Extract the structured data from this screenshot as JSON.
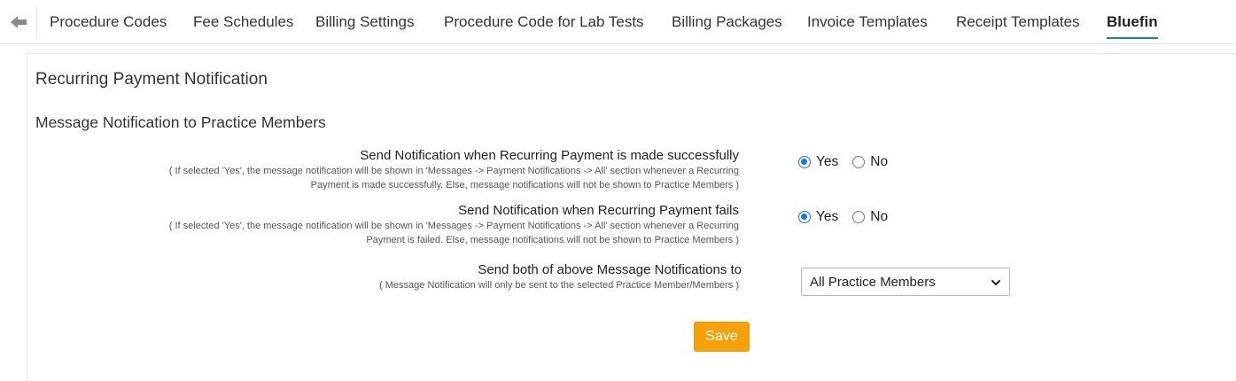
{
  "tabs": [
    {
      "label": "Procedure Codes"
    },
    {
      "label": "Fee Schedules"
    },
    {
      "label": "Billing Settings"
    },
    {
      "label": "Procedure Code for Lab Tests"
    },
    {
      "label": "Billing Packages"
    },
    {
      "label": "Invoice Templates"
    },
    {
      "label": "Receipt Templates"
    },
    {
      "label": "Bluefin"
    }
  ],
  "active_tab": "Bluefin",
  "page": {
    "title": "Recurring Payment Notification",
    "section_title": "Message Notification to Practice Members"
  },
  "settings": {
    "success": {
      "label": "Send Notification when Recurring Payment is made successfully",
      "help_line1": "( If selected 'Yes', the message notification will be shown in 'Messages -> Payment Notifications -> All' section whenever a Recurring",
      "help_line2": "Payment is made successfully. Else, message notifications will not be shown to Practice Members  )",
      "yes_label": "Yes",
      "no_label": "No",
      "selected": "Yes"
    },
    "fail": {
      "label": "Send Notification when Recurring Payment fails",
      "help_line1": "( If selected 'Yes', the message notification will be shown in 'Messages -> Payment Notifications -> All' section whenever a Recurring",
      "help_line2": "Payment is failed. Else, message notifications will not be shown to Practice Members  )",
      "yes_label": "Yes",
      "no_label": "No",
      "selected": "Yes"
    },
    "recipients": {
      "label": "Send both of above Message Notifications to",
      "help": "( Message Notification will only be sent to the selected Practice Member/Members  )",
      "selected_value": "All Practice Members"
    }
  },
  "buttons": {
    "save_label": "Save"
  },
  "colors": {
    "accent": "#1a8a87",
    "save_button": "#f5a20a",
    "radio_checked": "#1a73e8"
  }
}
